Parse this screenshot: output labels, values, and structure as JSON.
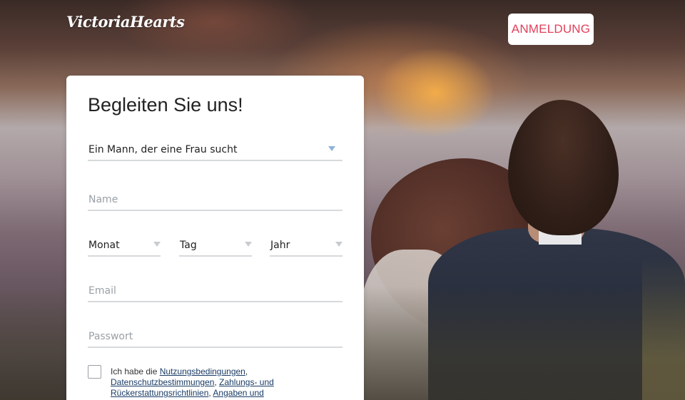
{
  "header": {
    "logo_text": "VictoriaHearts",
    "login_label": "ANMELDUNG"
  },
  "form": {
    "title": "Begleiten Sie uns!",
    "seeking_value": "Ein Mann, der eine Frau sucht",
    "name_placeholder": "Name",
    "dob": {
      "month_label": "Monat",
      "day_label": "Tag",
      "year_label": "Jahr"
    },
    "email_placeholder": "Email",
    "password_placeholder": "Passwort",
    "terms": {
      "prefix": "Ich habe die",
      "link_terms": "Nutzungsbedingungen",
      "sep1": ",",
      "link_privacy": "Datenschutzbestimmungen",
      "sep2": ",",
      "link_payment": "Zahlungs- und Rückerstattungsrichtlinien",
      "sep3": ",",
      "link_info": "Angaben und"
    }
  },
  "colors": {
    "accent": "#e2405b",
    "link": "#1a3c66",
    "caret": "#8fb3d9"
  }
}
